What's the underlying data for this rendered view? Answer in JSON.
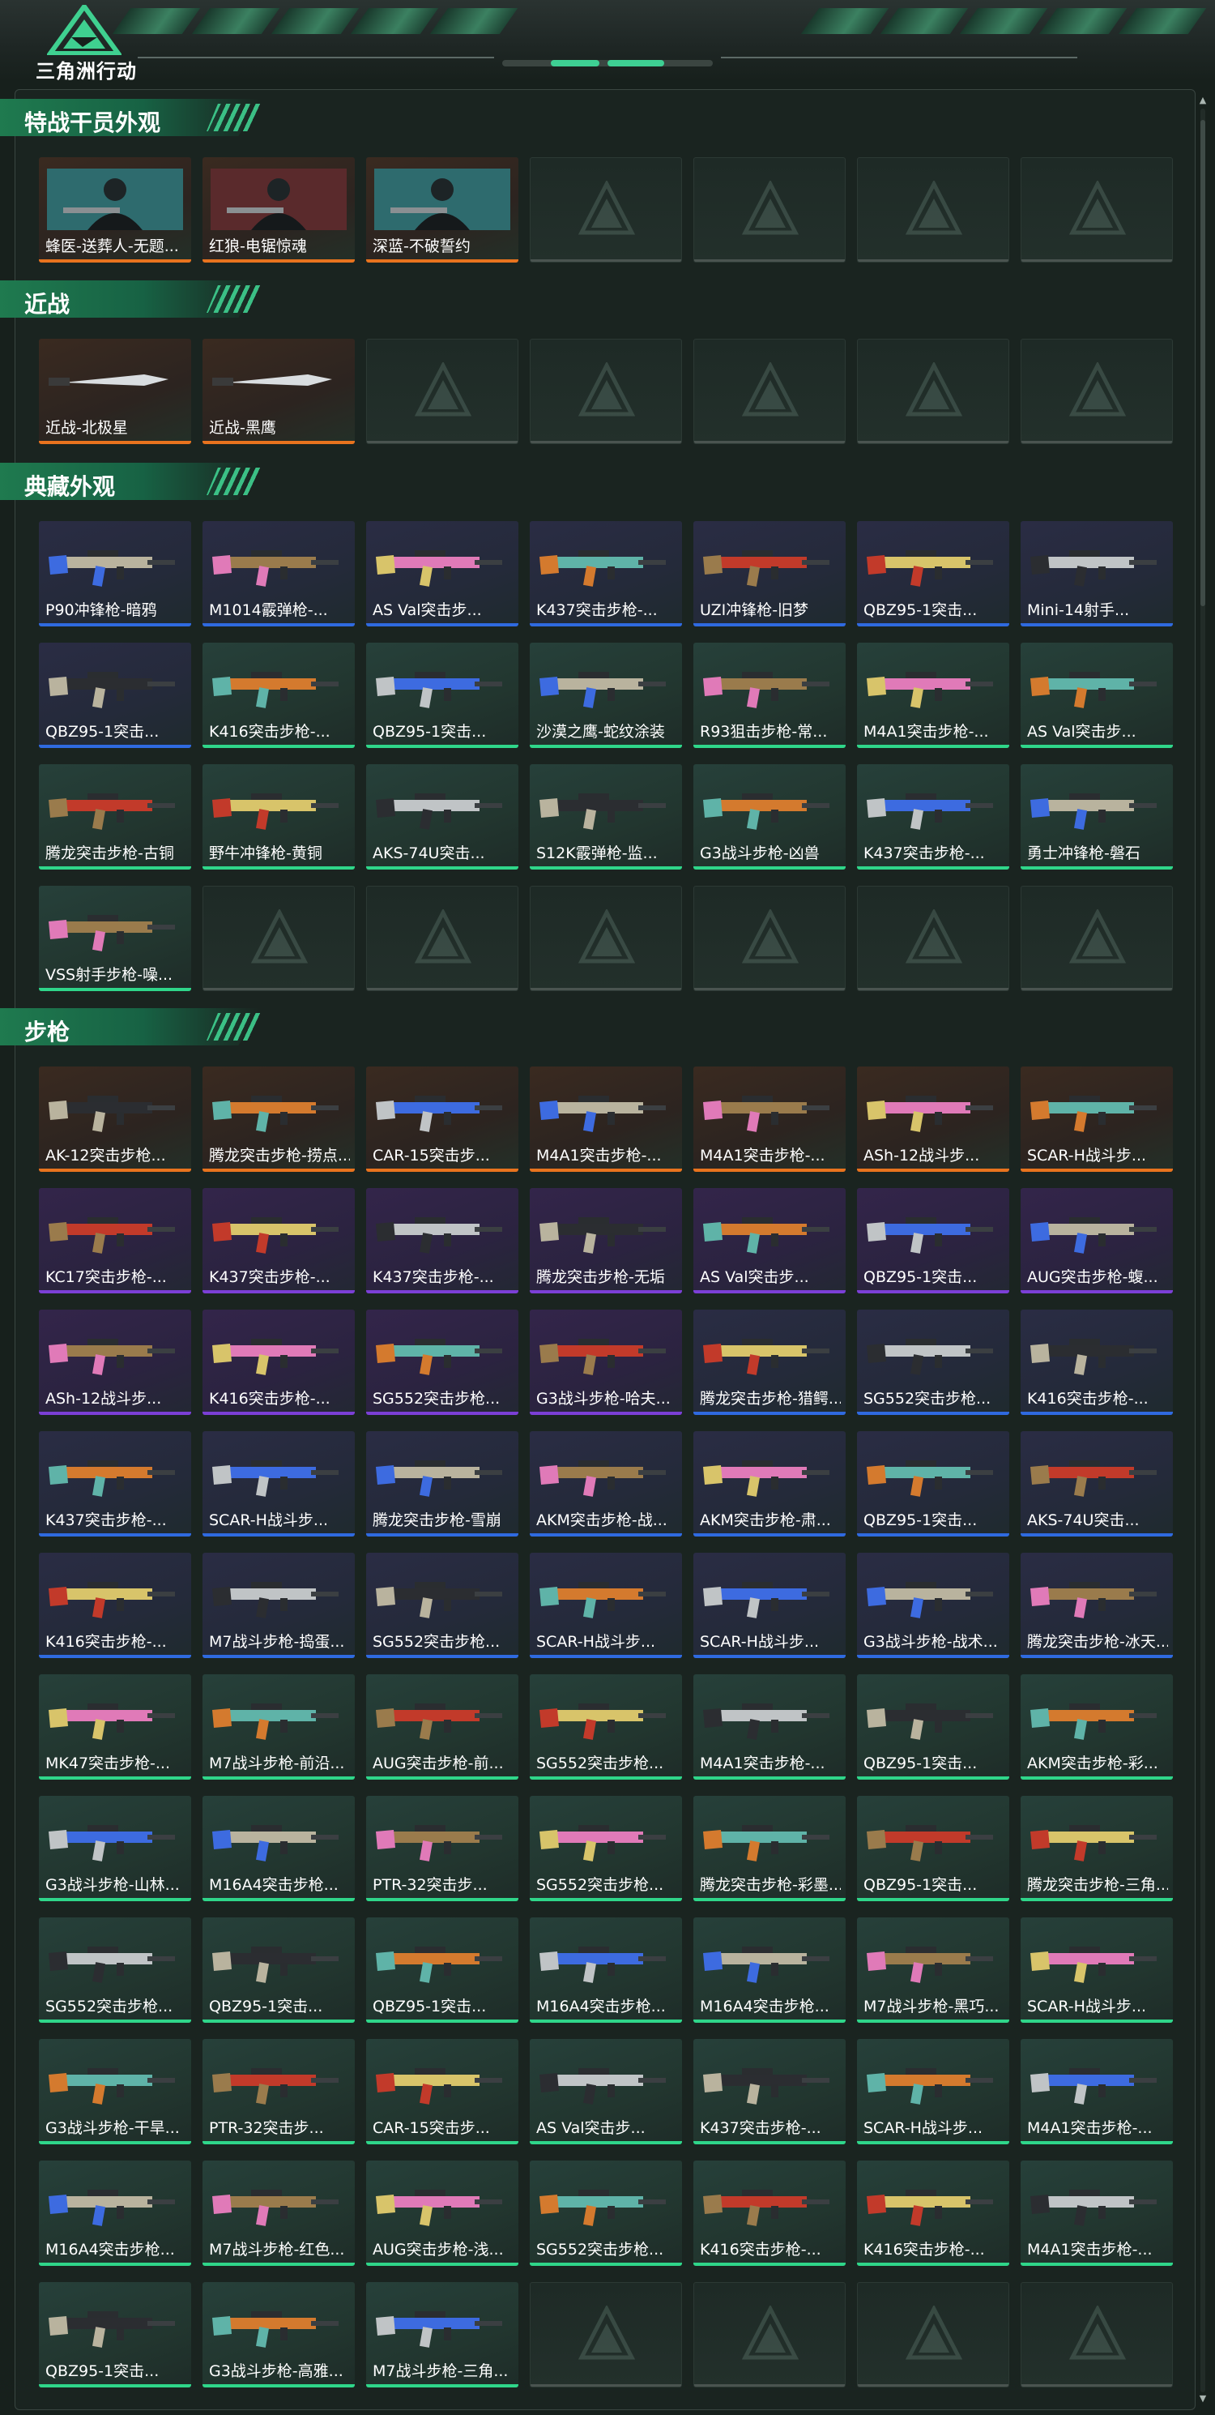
{
  "app": {
    "title": "三角洲行动"
  },
  "colors": {
    "orange": "#e8731e",
    "green": "#2fd68a",
    "blue": "#2f6ae0",
    "purple": "#7b3fd6",
    "empty": "#4a5450"
  },
  "sections": [
    {
      "title": "特战干员外观",
      "items": [
        {
          "name": "蜂医-送葬人-无题...",
          "rarity": "orange",
          "kind": "operator"
        },
        {
          "name": "红狼-电锯惊魂",
          "rarity": "orange",
          "kind": "operator"
        },
        {
          "name": "深蓝-不破誓约",
          "rarity": "orange",
          "kind": "operator"
        },
        {
          "empty": true
        },
        {
          "empty": true
        },
        {
          "empty": true
        },
        {
          "empty": true
        }
      ]
    },
    {
      "title": "近战",
      "items": [
        {
          "name": "近战-北极星",
          "rarity": "orange",
          "kind": "knife"
        },
        {
          "name": "近战-黑鹰",
          "rarity": "orange",
          "kind": "knife"
        },
        {
          "empty": true
        },
        {
          "empty": true
        },
        {
          "empty": true
        },
        {
          "empty": true
        },
        {
          "empty": true
        }
      ]
    },
    {
      "title": "典藏外观",
      "items": [
        {
          "name": "P90冲锋枪-暗鸦",
          "rarity": "blue",
          "kind": "gun"
        },
        {
          "name": "M1014霰弹枪-...",
          "rarity": "blue",
          "kind": "gun"
        },
        {
          "name": "AS Val突击步...",
          "rarity": "blue",
          "kind": "gun"
        },
        {
          "name": "K437突击步枪-...",
          "rarity": "blue",
          "kind": "gun"
        },
        {
          "name": "UZI冲锋枪-旧梦",
          "rarity": "blue",
          "kind": "gun"
        },
        {
          "name": "QBZ95-1突击...",
          "rarity": "blue",
          "kind": "gun"
        },
        {
          "name": "Mini-14射手...",
          "rarity": "blue",
          "kind": "gun"
        },
        {
          "name": "QBZ95-1突击...",
          "rarity": "blue",
          "kind": "gun"
        },
        {
          "name": "K416突击步枪-...",
          "rarity": "green",
          "kind": "gun"
        },
        {
          "name": "QBZ95-1突击...",
          "rarity": "green",
          "kind": "gun"
        },
        {
          "name": "沙漠之鹰-蛇纹涂装",
          "rarity": "green",
          "kind": "gun"
        },
        {
          "name": "R93狙击步枪-常...",
          "rarity": "green",
          "kind": "gun"
        },
        {
          "name": "M4A1突击步枪-...",
          "rarity": "green",
          "kind": "gun"
        },
        {
          "name": "AS Val突击步...",
          "rarity": "green",
          "kind": "gun"
        },
        {
          "name": "腾龙突击步枪-古铜",
          "rarity": "green",
          "kind": "gun"
        },
        {
          "name": "野牛冲锋枪-黄铜",
          "rarity": "green",
          "kind": "gun"
        },
        {
          "name": "AKS-74U突击...",
          "rarity": "green",
          "kind": "gun"
        },
        {
          "name": "S12K霰弹枪-监...",
          "rarity": "green",
          "kind": "gun"
        },
        {
          "name": "G3战斗步枪-凶兽",
          "rarity": "green",
          "kind": "gun"
        },
        {
          "name": "K437突击步枪-...",
          "rarity": "green",
          "kind": "gun"
        },
        {
          "name": "勇士冲锋枪-磐石",
          "rarity": "green",
          "kind": "gun"
        },
        {
          "name": "VSS射手步枪-噪...",
          "rarity": "green",
          "kind": "gun"
        },
        {
          "empty": true
        },
        {
          "empty": true
        },
        {
          "empty": true
        },
        {
          "empty": true
        },
        {
          "empty": true
        },
        {
          "empty": true
        }
      ]
    },
    {
      "title": "步枪",
      "items": [
        {
          "name": "AK-12突击步枪...",
          "rarity": "orange",
          "kind": "gun"
        },
        {
          "name": "腾龙突击步枪-捞点...",
          "rarity": "orange",
          "kind": "gun"
        },
        {
          "name": "CAR-15突击步...",
          "rarity": "orange",
          "kind": "gun"
        },
        {
          "name": "M4A1突击步枪-...",
          "rarity": "orange",
          "kind": "gun"
        },
        {
          "name": "M4A1突击步枪-...",
          "rarity": "orange",
          "kind": "gun"
        },
        {
          "name": "ASh-12战斗步...",
          "rarity": "orange",
          "kind": "gun"
        },
        {
          "name": "SCAR-H战斗步...",
          "rarity": "orange",
          "kind": "gun"
        },
        {
          "name": "KC17突击步枪-...",
          "rarity": "purple",
          "kind": "gun"
        },
        {
          "name": "K437突击步枪-...",
          "rarity": "purple",
          "kind": "gun"
        },
        {
          "name": "K437突击步枪-...",
          "rarity": "purple",
          "kind": "gun"
        },
        {
          "name": "腾龙突击步枪-无垢",
          "rarity": "purple",
          "kind": "gun"
        },
        {
          "name": "AS Val突击步...",
          "rarity": "purple",
          "kind": "gun"
        },
        {
          "name": "QBZ95-1突击...",
          "rarity": "purple",
          "kind": "gun"
        },
        {
          "name": "AUG突击步枪-蝮...",
          "rarity": "purple",
          "kind": "gun"
        },
        {
          "name": "ASh-12战斗步...",
          "rarity": "purple",
          "kind": "gun"
        },
        {
          "name": "K416突击步枪-...",
          "rarity": "purple",
          "kind": "gun"
        },
        {
          "name": "SG552突击步枪...",
          "rarity": "purple",
          "kind": "gun"
        },
        {
          "name": "G3战斗步枪-哈夫...",
          "rarity": "purple",
          "kind": "gun"
        },
        {
          "name": "腾龙突击步枪-猎鳄...",
          "rarity": "blue",
          "kind": "gun"
        },
        {
          "name": "SG552突击步枪...",
          "rarity": "blue",
          "kind": "gun"
        },
        {
          "name": "K416突击步枪-...",
          "rarity": "blue",
          "kind": "gun"
        },
        {
          "name": "K437突击步枪-...",
          "rarity": "blue",
          "kind": "gun"
        },
        {
          "name": "SCAR-H战斗步...",
          "rarity": "blue",
          "kind": "gun"
        },
        {
          "name": "腾龙突击步枪-雪崩",
          "rarity": "blue",
          "kind": "gun"
        },
        {
          "name": "AKM突击步枪-战...",
          "rarity": "blue",
          "kind": "gun"
        },
        {
          "name": "AKM突击步枪-肃...",
          "rarity": "blue",
          "kind": "gun"
        },
        {
          "name": "QBZ95-1突击...",
          "rarity": "blue",
          "kind": "gun"
        },
        {
          "name": "AKS-74U突击...",
          "rarity": "blue",
          "kind": "gun"
        },
        {
          "name": "K416突击步枪-...",
          "rarity": "blue",
          "kind": "gun"
        },
        {
          "name": "M7战斗步枪-捣蛋...",
          "rarity": "blue",
          "kind": "gun"
        },
        {
          "name": "SG552突击步枪...",
          "rarity": "blue",
          "kind": "gun"
        },
        {
          "name": "SCAR-H战斗步...",
          "rarity": "blue",
          "kind": "gun"
        },
        {
          "name": "SCAR-H战斗步...",
          "rarity": "blue",
          "kind": "gun"
        },
        {
          "name": "G3战斗步枪-战术...",
          "rarity": "blue",
          "kind": "gun"
        },
        {
          "name": "腾龙突击步枪-冰天...",
          "rarity": "blue",
          "kind": "gun"
        },
        {
          "name": "MK47突击步枪-...",
          "rarity": "green",
          "kind": "gun"
        },
        {
          "name": "M7战斗步枪-前沿...",
          "rarity": "green",
          "kind": "gun"
        },
        {
          "name": "AUG突击步枪-前...",
          "rarity": "green",
          "kind": "gun"
        },
        {
          "name": "SG552突击步枪...",
          "rarity": "green",
          "kind": "gun"
        },
        {
          "name": "M4A1突击步枪-...",
          "rarity": "green",
          "kind": "gun"
        },
        {
          "name": "QBZ95-1突击...",
          "rarity": "green",
          "kind": "gun"
        },
        {
          "name": "AKM突击步枪-彩...",
          "rarity": "green",
          "kind": "gun"
        },
        {
          "name": "G3战斗步枪-山林...",
          "rarity": "green",
          "kind": "gun"
        },
        {
          "name": "M16A4突击步枪...",
          "rarity": "green",
          "kind": "gun"
        },
        {
          "name": "PTR-32突击步...",
          "rarity": "green",
          "kind": "gun"
        },
        {
          "name": "SG552突击步枪...",
          "rarity": "green",
          "kind": "gun"
        },
        {
          "name": "腾龙突击步枪-彩墨...",
          "rarity": "green",
          "kind": "gun"
        },
        {
          "name": "QBZ95-1突击...",
          "rarity": "green",
          "kind": "gun"
        },
        {
          "name": "腾龙突击步枪-三角...",
          "rarity": "green",
          "kind": "gun"
        },
        {
          "name": "SG552突击步枪...",
          "rarity": "green",
          "kind": "gun"
        },
        {
          "name": "QBZ95-1突击...",
          "rarity": "green",
          "kind": "gun"
        },
        {
          "name": "QBZ95-1突击...",
          "rarity": "green",
          "kind": "gun"
        },
        {
          "name": "M16A4突击步枪...",
          "rarity": "green",
          "kind": "gun"
        },
        {
          "name": "M16A4突击步枪...",
          "rarity": "green",
          "kind": "gun"
        },
        {
          "name": "M7战斗步枪-黑巧...",
          "rarity": "green",
          "kind": "gun"
        },
        {
          "name": "SCAR-H战斗步...",
          "rarity": "green",
          "kind": "gun"
        },
        {
          "name": "G3战斗步枪-干旱...",
          "rarity": "green",
          "kind": "gun"
        },
        {
          "name": "PTR-32突击步...",
          "rarity": "green",
          "kind": "gun"
        },
        {
          "name": "CAR-15突击步...",
          "rarity": "green",
          "kind": "gun"
        },
        {
          "name": "AS Val突击步...",
          "rarity": "green",
          "kind": "gun"
        },
        {
          "name": "K437突击步枪-...",
          "rarity": "green",
          "kind": "gun"
        },
        {
          "name": "SCAR-H战斗步...",
          "rarity": "green",
          "kind": "gun"
        },
        {
          "name": "M4A1突击步枪-...",
          "rarity": "green",
          "kind": "gun"
        },
        {
          "name": "M16A4突击步枪...",
          "rarity": "green",
          "kind": "gun"
        },
        {
          "name": "M7战斗步枪-红色...",
          "rarity": "green",
          "kind": "gun"
        },
        {
          "name": "AUG突击步枪-浅...",
          "rarity": "green",
          "kind": "gun"
        },
        {
          "name": "SG552突击步枪...",
          "rarity": "green",
          "kind": "gun"
        },
        {
          "name": "K416突击步枪-...",
          "rarity": "green",
          "kind": "gun"
        },
        {
          "name": "K416突击步枪-...",
          "rarity": "green",
          "kind": "gun"
        },
        {
          "name": "M4A1突击步枪-...",
          "rarity": "green",
          "kind": "gun"
        },
        {
          "name": "QBZ95-1突击...",
          "rarity": "green",
          "kind": "gun"
        },
        {
          "name": "G3战斗步枪-高雅...",
          "rarity": "green",
          "kind": "gun"
        },
        {
          "name": "M7战斗步枪-三角...",
          "rarity": "green",
          "kind": "gun"
        },
        {
          "empty": true
        },
        {
          "empty": true
        },
        {
          "empty": true
        },
        {
          "empty": true
        }
      ]
    }
  ]
}
